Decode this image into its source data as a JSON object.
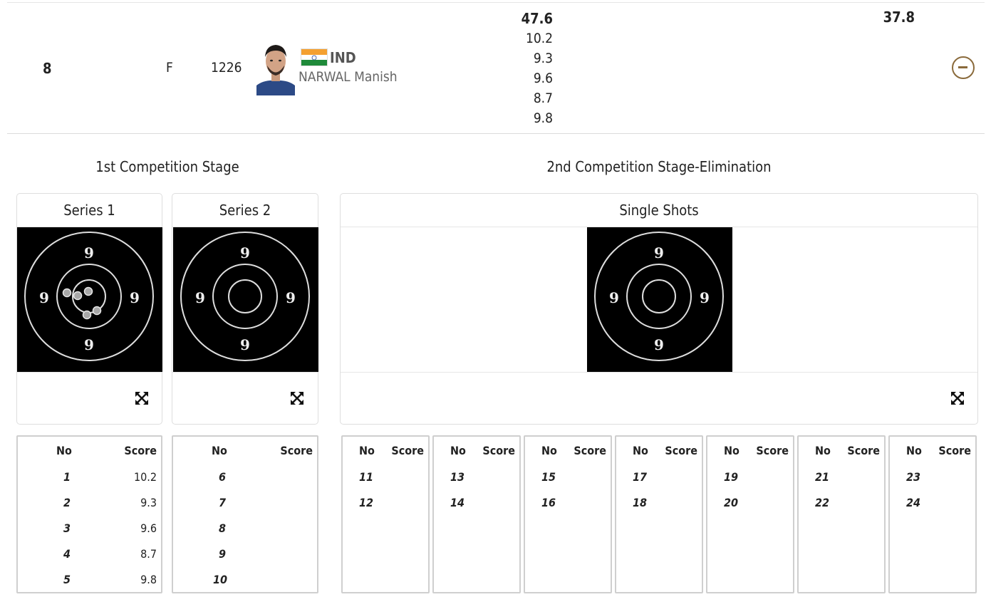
{
  "athlete": {
    "rank": "8",
    "qualification": "F",
    "bib": "1226",
    "noc": "IND",
    "name": "NARWAL Manish",
    "stage1_total": "47.6",
    "stage1_shots": [
      "10.2",
      "9.3",
      "9.6",
      "8.7",
      "9.8"
    ],
    "stage2_total": "37.8"
  },
  "stages": {
    "first": "1st Competition Stage",
    "second": "2nd Competition Stage-Elimination"
  },
  "cards": {
    "series1": "Series 1",
    "series2": "Series 2",
    "single": "Single Shots",
    "ring_label": "9"
  },
  "table_headers": {
    "no": "No",
    "score": "Score"
  },
  "series1_rows": [
    {
      "no": "1",
      "score": "10.2"
    },
    {
      "no": "2",
      "score": "9.3"
    },
    {
      "no": "3",
      "score": "9.6"
    },
    {
      "no": "4",
      "score": "8.7"
    },
    {
      "no": "5",
      "score": "9.8"
    }
  ],
  "series2_rows": [
    {
      "no": "6",
      "score": ""
    },
    {
      "no": "7",
      "score": ""
    },
    {
      "no": "8",
      "score": ""
    },
    {
      "no": "9",
      "score": ""
    },
    {
      "no": "10",
      "score": ""
    }
  ],
  "single_tables": [
    [
      {
        "no": "11"
      },
      {
        "no": "12"
      }
    ],
    [
      {
        "no": "13"
      },
      {
        "no": "14"
      }
    ],
    [
      {
        "no": "15"
      },
      {
        "no": "16"
      }
    ],
    [
      {
        "no": "17"
      },
      {
        "no": "18"
      }
    ],
    [
      {
        "no": "19"
      },
      {
        "no": "20"
      }
    ],
    [
      {
        "no": "21"
      },
      {
        "no": "22"
      }
    ],
    [
      {
        "no": "23"
      },
      {
        "no": "24"
      }
    ]
  ],
  "colors": {
    "accent": "#8a6a3b",
    "flag_saffron": "#f4a030",
    "flag_green": "#1f8a3a",
    "chakra": "#1c3f94"
  }
}
